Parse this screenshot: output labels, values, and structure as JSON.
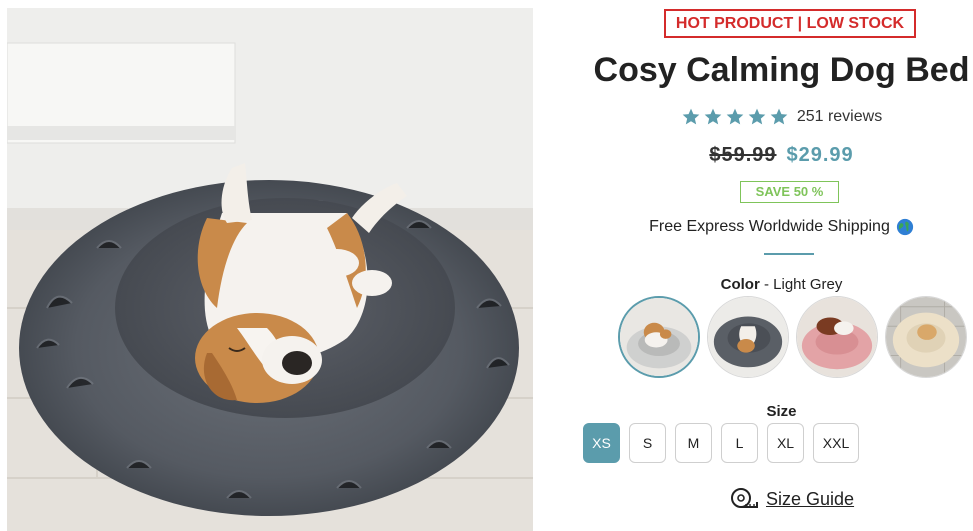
{
  "product": {
    "badge": "HOT PRODUCT | LOW STOCK",
    "title": "Cosy Calming Dog Bed",
    "rating": 5,
    "reviews": "251 reviews",
    "old_price": "$59.99",
    "new_price": "$29.99",
    "save": "SAVE 50 %",
    "shipping": "Free Express Worldwide Shipping"
  },
  "color": {
    "label": "Color",
    "selected_value": "Light Grey",
    "swatches": [
      {
        "name": "Light Grey",
        "selected": true,
        "bed": "#cfd0cf"
      },
      {
        "name": "Dark Grey",
        "selected": false,
        "bed": "#5a5f66"
      },
      {
        "name": "Pink",
        "selected": false,
        "bed": "#e3a3a6"
      },
      {
        "name": "Beige",
        "selected": false,
        "bed": "#ece0c8"
      }
    ]
  },
  "size": {
    "label": "Size",
    "options": [
      "XS",
      "S",
      "M",
      "L",
      "XL",
      "XXL"
    ],
    "selected": "XS"
  },
  "size_guide": "Size Guide",
  "colors": {
    "accent": "#5b9cac",
    "badge_red": "#d42b2b",
    "save_green": "#7fc45a"
  },
  "icons": {
    "star": "star-icon",
    "globe": "globe-icon",
    "tape": "tape-measure-icon"
  }
}
